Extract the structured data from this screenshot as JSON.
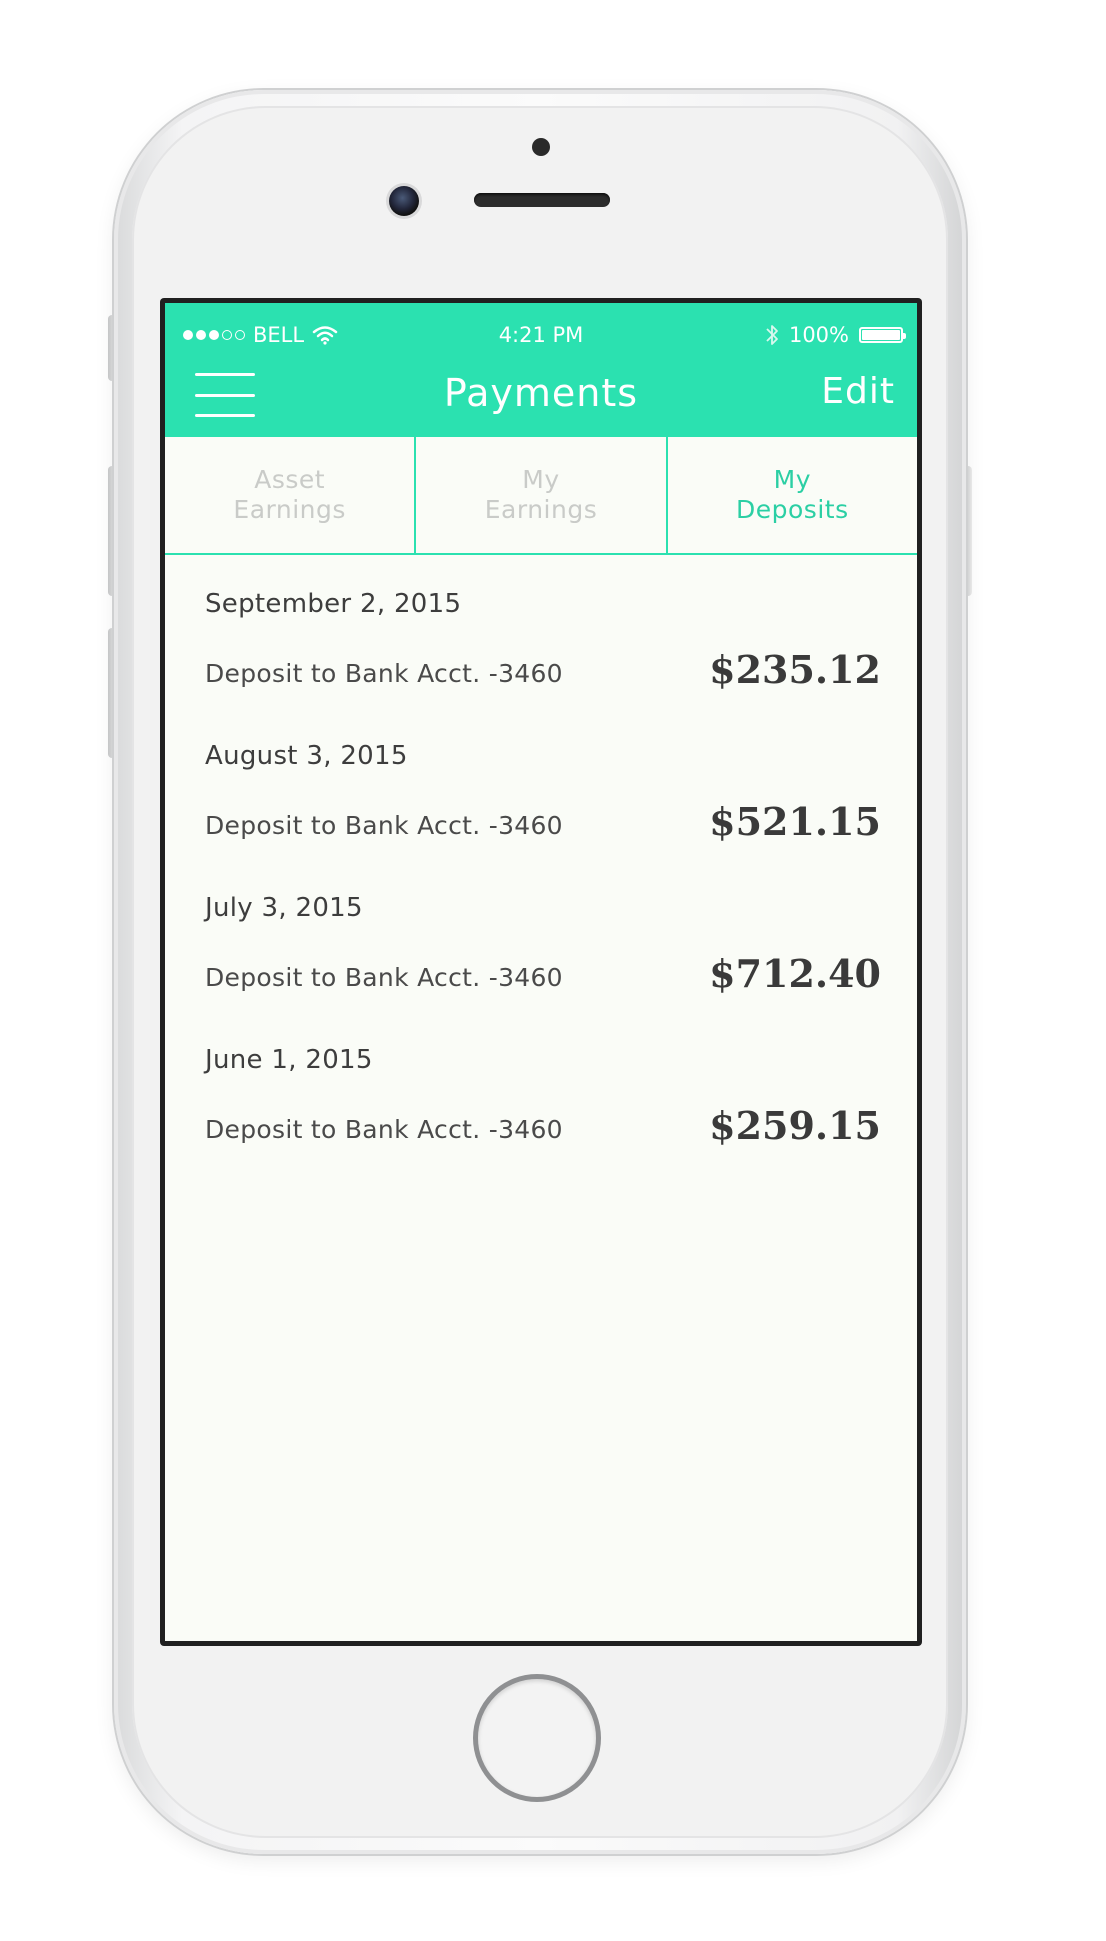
{
  "status_bar": {
    "carrier": "BELL",
    "time": "4:21 PM",
    "battery": "100%",
    "signal_bars": 3,
    "signal_total": 5,
    "battery_level": 1.0
  },
  "header": {
    "title": "Payments",
    "edit_label": "Edit"
  },
  "tabs": [
    {
      "label": "Asset\nEarnings",
      "active": false
    },
    {
      "label": "My\nEarnings",
      "active": false
    },
    {
      "label": "My\nDeposits",
      "active": true
    }
  ],
  "deposits": [
    {
      "date": "September 2, 2015",
      "description": "Deposit to Bank Acct. -3460",
      "amount": "$235.12"
    },
    {
      "date": "August 3, 2015",
      "description": "Deposit to Bank Acct. -3460",
      "amount": "$521.15"
    },
    {
      "date": "July 3, 2015",
      "description": "Deposit to Bank Acct. -3460",
      "amount": "$712.40"
    },
    {
      "date": "June 1, 2015",
      "description": "Deposit to Bank Acct. -3460",
      "amount": "$259.15"
    }
  ],
  "colors": {
    "accent": "#2be1b0",
    "accent_text": "#2bcfa4",
    "background": "#fafcf7"
  },
  "icons": {
    "menu": "hamburger-menu-icon",
    "wifi": "wifi-icon",
    "bluetooth": "bluetooth-icon",
    "battery": "battery-icon"
  }
}
